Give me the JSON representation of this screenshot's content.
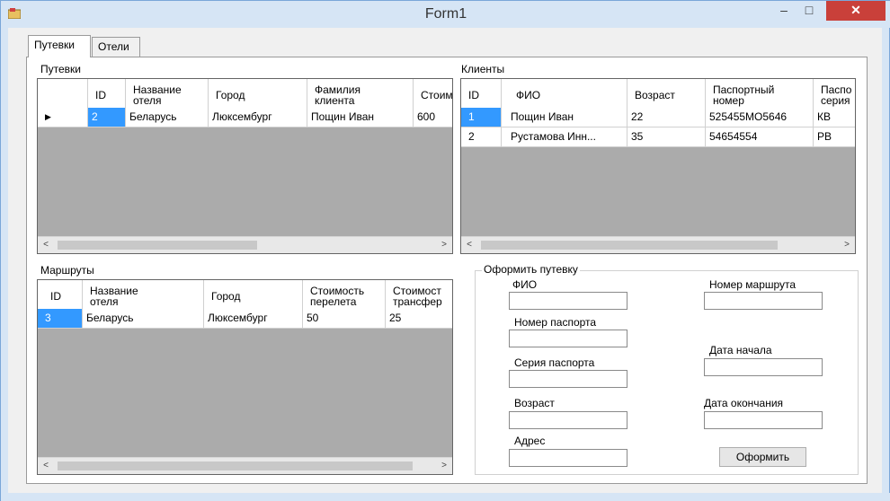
{
  "window": {
    "title": "Form1",
    "minimize": "‒",
    "maximize": "□",
    "close": "✕",
    "icon": "app-icon"
  },
  "tabs": [
    {
      "label": "Путевки"
    },
    {
      "label": "Отели"
    }
  ],
  "trips": {
    "title": "Путевки",
    "columns": [
      "",
      "ID",
      "Название\nотеля",
      "Город",
      "Фамилия\nклиента",
      "Стоим"
    ],
    "rows": [
      {
        "indicator": "▶",
        "id": "2",
        "hotel": "Беларусь",
        "city": "Люксембург",
        "client": "Пощин Иван",
        "cost": "600"
      }
    ]
  },
  "clients": {
    "title": "Клиенты",
    "columns": [
      "ID",
      "ФИО",
      "Возраст",
      "Паспортный\nномер",
      "Паспо\nсерия"
    ],
    "rows": [
      {
        "id": "1",
        "name": "Пощин Иван",
        "age": "22",
        "passport": "525455МО5646",
        "series": "КВ"
      },
      {
        "id": "2",
        "name": "Рустамова Инн...",
        "age": "35",
        "passport": "54654554",
        "series": "РВ"
      }
    ]
  },
  "routes": {
    "title": "Маршруты",
    "columns": [
      "ID",
      "Название\nотеля",
      "Город",
      "Стоимость\nперелета",
      "Стоимост\nтрансфер"
    ],
    "rows": [
      {
        "id": "3",
        "hotel": "Беларусь",
        "city": "Люксембург",
        "flight": "50",
        "transfer": "25"
      }
    ]
  },
  "form": {
    "title": "Оформить путевку",
    "fio": "ФИО",
    "passport_number": "Номер паспорта",
    "passport_series": "Серия паспорта",
    "age": "Возраст",
    "address": "Адрес",
    "route_number": "Номер маршрута",
    "start_date": "Дата начала",
    "end_date": "Дата окончания",
    "submit": "Оформить"
  },
  "scroll": {
    "left": "<",
    "right": ">"
  }
}
